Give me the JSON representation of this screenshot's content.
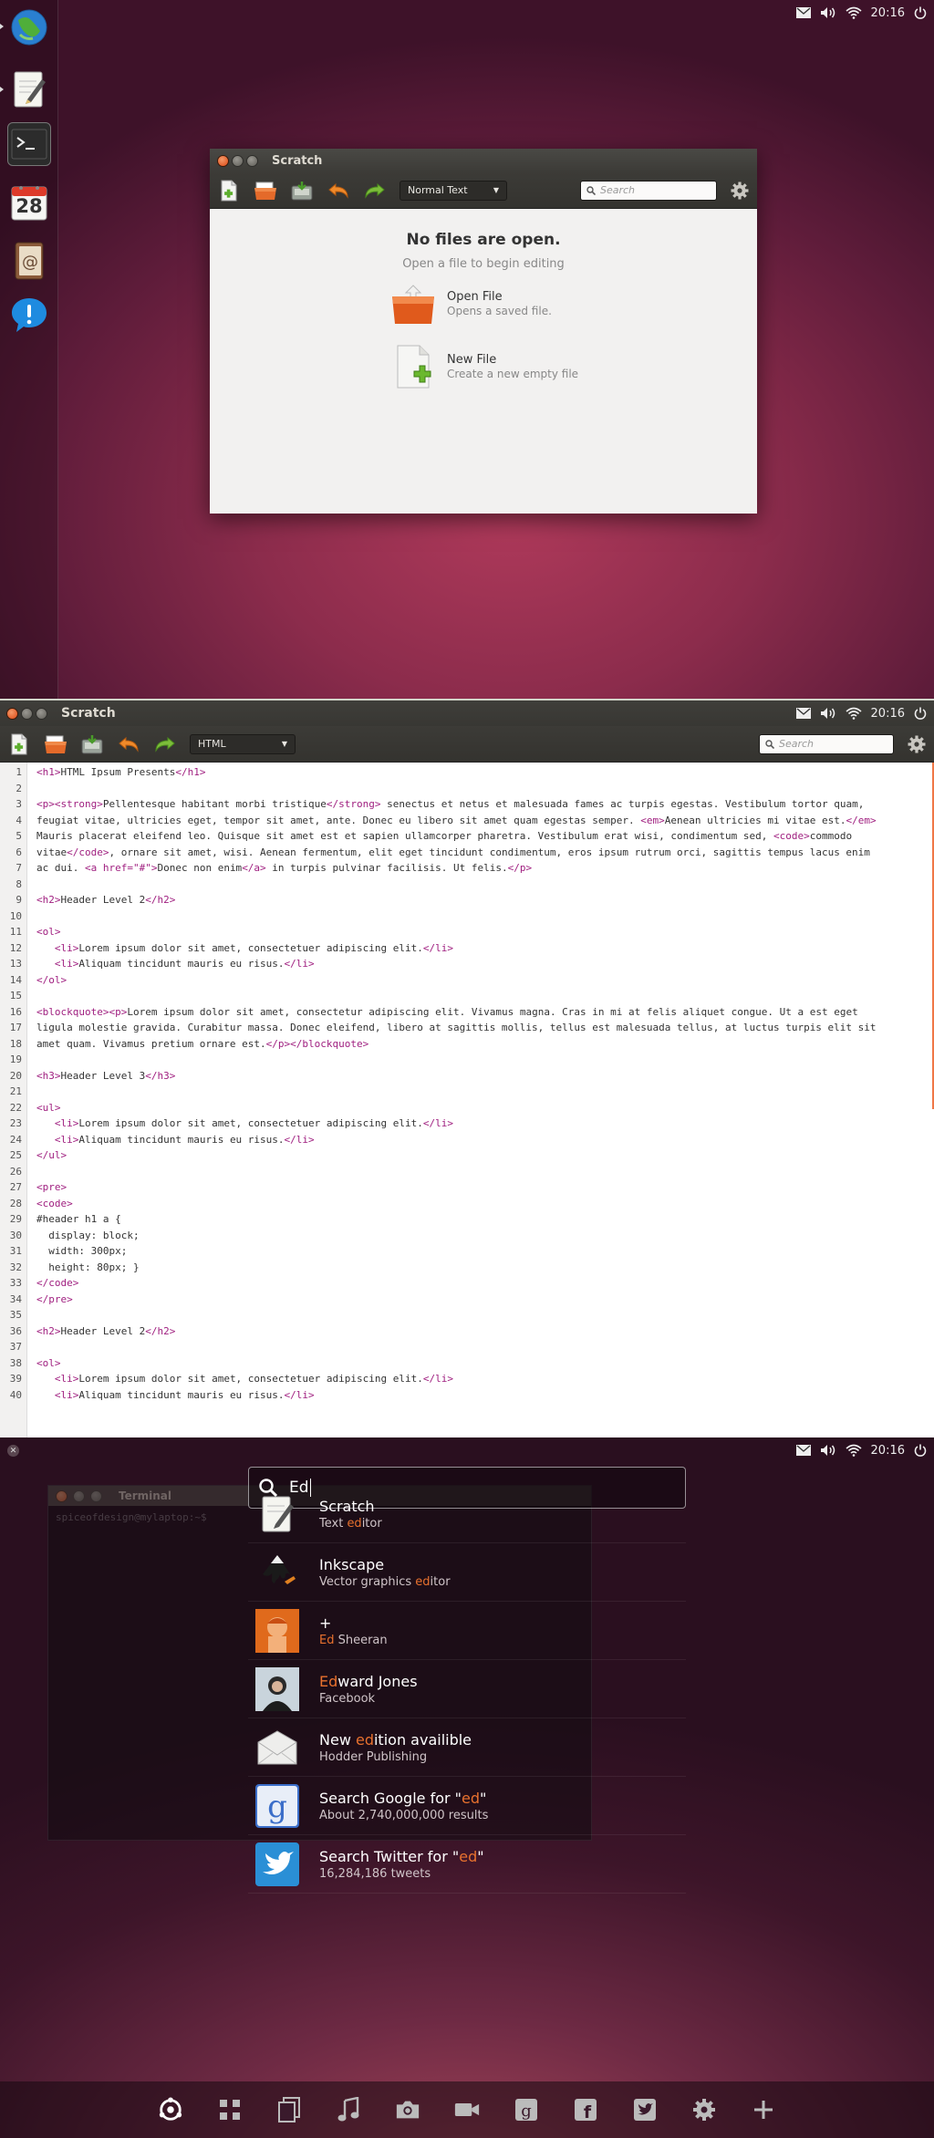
{
  "indicators": {
    "time": "20:16"
  },
  "desktop": {
    "launcher": [
      "browser",
      "text-editor",
      "terminal",
      "calendar",
      "contacts",
      "notifications"
    ],
    "calendar_day": "28",
    "window": {
      "title": "Scratch",
      "syntax_mode": "Normal Text",
      "search_placeholder": "Search",
      "welcome_title": "No files are open.",
      "welcome_sub": "Open a file to begin editing",
      "open_file_title": "Open File",
      "open_file_sub": "Opens a saved file.",
      "new_file_title": "New File",
      "new_file_sub": "Create a new empty file"
    }
  },
  "editor": {
    "title": "Scratch",
    "syntax_mode": "HTML",
    "search_placeholder": "Search",
    "lines": [
      {
        "n": "1",
        "t": "<h1>HTML Ipsum Presents</h1>"
      },
      {
        "n": "2",
        "t": ""
      },
      {
        "n": "3",
        "t": "<p><strong>Pellentesque habitant morbi tristique</strong> senectus et netus et malesuada fames ac turpis egestas. Vestibulum tortor quam,"
      },
      {
        "n": "4",
        "t": "feugiat vitae, ultricies eget, tempor sit amet, ante. Donec eu libero sit amet quam egestas semper. <em>Aenean ultricies mi vitae est.</em>"
      },
      {
        "n": "5",
        "t": "Mauris placerat eleifend leo. Quisque sit amet est et sapien ullamcorper pharetra. Vestibulum erat wisi, condimentum sed, <code>commodo"
      },
      {
        "n": "6",
        "t": "vitae</code>, ornare sit amet, wisi. Aenean fermentum, elit eget tincidunt condimentum, eros ipsum rutrum orci, sagittis tempus lacus enim"
      },
      {
        "n": "7",
        "t": "ac dui. <a href=\"#\">Donec non enim</a> in turpis pulvinar facilisis. Ut felis.</p>"
      },
      {
        "n": "8",
        "t": ""
      },
      {
        "n": "9",
        "t": "<h2>Header Level 2</h2>"
      },
      {
        "n": "10",
        "t": ""
      },
      {
        "n": "11",
        "t": "<ol>"
      },
      {
        "n": "12",
        "t": "   <li>Lorem ipsum dolor sit amet, consectetuer adipiscing elit.</li>"
      },
      {
        "n": "13",
        "t": "   <li>Aliquam tincidunt mauris eu risus.</li>"
      },
      {
        "n": "14",
        "t": "</ol>"
      },
      {
        "n": "15",
        "t": ""
      },
      {
        "n": "16",
        "t": "<blockquote><p>Lorem ipsum dolor sit amet, consectetur adipiscing elit. Vivamus magna. Cras in mi at felis aliquet congue. Ut a est eget"
      },
      {
        "n": "17",
        "t": "ligula molestie gravida. Curabitur massa. Donec eleifend, libero at sagittis mollis, tellus est malesuada tellus, at luctus turpis elit sit"
      },
      {
        "n": "18",
        "t": "amet quam. Vivamus pretium ornare est.</p></blockquote>"
      },
      {
        "n": "19",
        "t": ""
      },
      {
        "n": "20",
        "t": "<h3>Header Level 3</h3>"
      },
      {
        "n": "21",
        "t": ""
      },
      {
        "n": "22",
        "t": "<ul>"
      },
      {
        "n": "23",
        "t": "   <li>Lorem ipsum dolor sit amet, consectetuer adipiscing elit.</li>"
      },
      {
        "n": "24",
        "t": "   <li>Aliquam tincidunt mauris eu risus.</li>"
      },
      {
        "n": "25",
        "t": "</ul>"
      },
      {
        "n": "26",
        "t": ""
      },
      {
        "n": "27",
        "t": "<pre>"
      },
      {
        "n": "28",
        "t": "<code>"
      },
      {
        "n": "29",
        "t": "#header h1 a {"
      },
      {
        "n": "30",
        "t": "  display: block;"
      },
      {
        "n": "31",
        "t": "  width: 300px;"
      },
      {
        "n": "32",
        "t": "  height: 80px; }"
      },
      {
        "n": "33",
        "t": "</code>"
      },
      {
        "n": "34",
        "t": "</pre>"
      },
      {
        "n": "35",
        "t": ""
      },
      {
        "n": "36",
        "t": "<h2>Header Level 2</h2>"
      },
      {
        "n": "37",
        "t": ""
      },
      {
        "n": "38",
        "t": "<ol>"
      },
      {
        "n": "39",
        "t": "   <li>Lorem ipsum dolor sit amet, consectetuer adipiscing elit.</li>"
      },
      {
        "n": "40",
        "t": "   <li>Aliquam tincidunt mauris eu risus.</li>"
      }
    ]
  },
  "dash": {
    "background_window_title": "Terminal",
    "background_terminal_prompt": "spiceofdesign@mylaptop:~$",
    "query": "Ed",
    "results": [
      {
        "icon": "text-editor-icon",
        "title_pre": "Scratch",
        "title_hl": "",
        "title_post": "",
        "sub_pre": "Text ",
        "sub_hl": "ed",
        "sub_post": "itor"
      },
      {
        "icon": "inkscape-icon",
        "title_pre": "Inkscape",
        "title_hl": "",
        "title_post": "",
        "sub_pre": "Vector graphics ",
        "sub_hl": "ed",
        "sub_post": "itor"
      },
      {
        "icon": "album-art-icon",
        "title_pre": "+",
        "title_hl": "",
        "title_post": "",
        "sub_pre": "",
        "sub_hl": "Ed",
        "sub_post": " Sheeran"
      },
      {
        "icon": "person-avatar-icon",
        "title_pre": "",
        "title_hl": "Ed",
        "title_post": "ward Jones",
        "sub_pre": "Facebook",
        "sub_hl": "",
        "sub_post": ""
      },
      {
        "icon": "mail-envelope-icon",
        "title_pre": "New ",
        "title_hl": "ed",
        "title_post": "ition availible",
        "sub_pre": "Hodder Publishing",
        "sub_hl": "",
        "sub_post": ""
      },
      {
        "icon": "google-icon",
        "title_pre": "Search Google for \"",
        "title_hl": "ed",
        "title_post": "\"",
        "sub_pre": "About 2,740,000,000 results",
        "sub_hl": "",
        "sub_post": ""
      },
      {
        "icon": "twitter-icon",
        "title_pre": "Search Twitter for \"",
        "title_hl": "ed",
        "title_post": "\"",
        "sub_pre": "16,284,186 tweets",
        "sub_hl": "",
        "sub_post": ""
      }
    ],
    "lenses": [
      "home",
      "applications",
      "files",
      "music",
      "photos",
      "video",
      "google",
      "facebook",
      "twitter",
      "settings",
      "more"
    ]
  }
}
